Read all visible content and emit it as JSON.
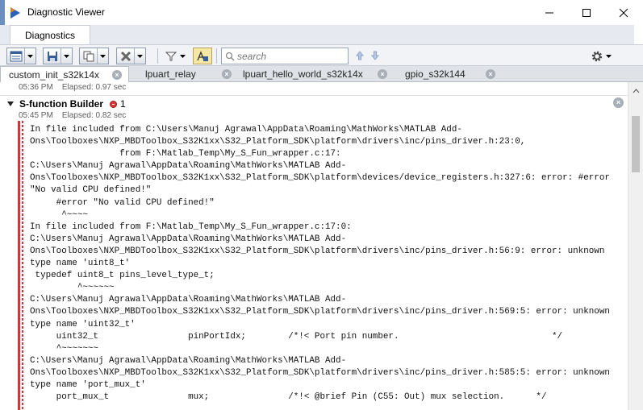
{
  "window": {
    "title": "Diagnostic Viewer"
  },
  "ribbon": {
    "tab_label": "Diagnostics"
  },
  "toolbar": {
    "search_placeholder": "search"
  },
  "tabs": [
    {
      "label": "custom_init_s32k14x",
      "active": true
    },
    {
      "label": "lpuart_relay",
      "active": false
    },
    {
      "label": "lpuart_hello_world_s32k14x",
      "active": false
    },
    {
      "label": "gpio_s32k144",
      "active": false
    }
  ],
  "previous_entry": {
    "time": "05:36 PM",
    "elapsed": "Elapsed: 0.97 sec"
  },
  "section": {
    "title": "S-function Builder",
    "error_count": "1",
    "time": "05:45 PM",
    "elapsed": "Elapsed: 0.82 sec"
  },
  "log_lines": [
    "In file included from C:\\Users\\Manuj Agrawal\\AppData\\Roaming\\MathWorks\\MATLAB Add-",
    "Ons\\Toolboxes\\NXP_MBDToolbox_S32K1xx\\S32_Platform_SDK\\platform\\drivers\\inc/pins_driver.h:23:0,",
    "                 from F:\\Matlab_Temp\\My_S_Fun_wrapper.c:17:",
    "C:\\Users\\Manuj Agrawal\\AppData\\Roaming\\MathWorks\\MATLAB Add-",
    "Ons\\Toolboxes\\NXP_MBDToolbox_S32K1xx\\S32_Platform_SDK\\platform\\devices/device_registers.h:327:6: error: #error",
    "\"No valid CPU defined!\"",
    "     #error \"No valid CPU defined!\"",
    "      ^~~~~",
    "In file included from F:\\Matlab_Temp\\My_S_Fun_wrapper.c:17:0:",
    "C:\\Users\\Manuj Agrawal\\AppData\\Roaming\\MathWorks\\MATLAB Add-",
    "Ons\\Toolboxes\\NXP_MBDToolbox_S32K1xx\\S32_Platform_SDK\\platform\\drivers\\inc/pins_driver.h:56:9: error: unknown",
    "type name 'uint8_t'",
    " typedef uint8_t pins_level_type_t;",
    "         ^~~~~~~",
    "C:\\Users\\Manuj Agrawal\\AppData\\Roaming\\MathWorks\\MATLAB Add-",
    "Ons\\Toolboxes\\NXP_MBDToolbox_S32K1xx\\S32_Platform_SDK\\platform\\drivers\\inc/pins_driver.h:569:5: error: unknown",
    "type name 'uint32_t'",
    "     uint32_t                 pinPortIdx;        /*!< Port pin number.                             */",
    "     ^~~~~~~~",
    "C:\\Users\\Manuj Agrawal\\AppData\\Roaming\\MathWorks\\MATLAB Add-",
    "Ons\\Toolboxes\\NXP_MBDToolbox_S32K1xx\\S32_Platform_SDK\\platform\\drivers\\inc/pins_driver.h:585:5: error: unknown",
    "type name 'port_mux_t'",
    "     port_mux_t               mux;               /*!< @brief Pin (C55: Out) mux selection.      */"
  ],
  "colors": {
    "error_red": "#d33838",
    "ribbon_bg": "#e6e9ef",
    "tabstrip_bg": "#dfe3e8"
  },
  "icons": [
    "app-icon",
    "minimize-icon",
    "maximize-icon",
    "close-icon",
    "report-icon",
    "save-icon",
    "copy-icon",
    "clear-icon",
    "filter-icon",
    "highlight-icon",
    "search-icon",
    "arrow-up-icon",
    "arrow-down-icon",
    "gear-icon",
    "chevron-down-icon",
    "error-icon",
    "scroll-up-icon"
  ]
}
